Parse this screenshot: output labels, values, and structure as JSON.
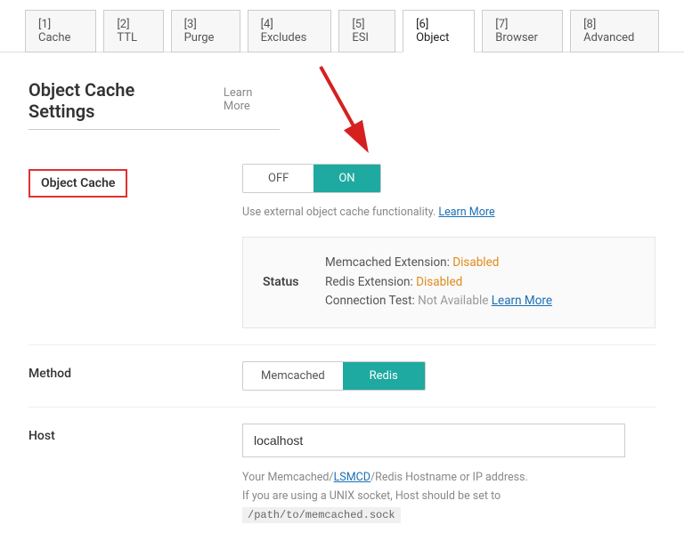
{
  "tabs": [
    {
      "label": "[1] Cache"
    },
    {
      "label": "[2] TTL"
    },
    {
      "label": "[3] Purge"
    },
    {
      "label": "[4] Excludes"
    },
    {
      "label": "[5] ESI"
    },
    {
      "label": "[6] Object"
    },
    {
      "label": "[7] Browser"
    },
    {
      "label": "[8] Advanced"
    }
  ],
  "active_tab_index": 5,
  "heading": "Object Cache Settings",
  "learn_more": "Learn More",
  "rows": {
    "object_cache": {
      "label": "Object Cache",
      "off": "OFF",
      "on": "ON",
      "desc_prefix": "Use external object cache functionality. ",
      "desc_link": "Learn More"
    },
    "status": {
      "label": "Status",
      "memcached_label": "Memcached Extension: ",
      "memcached_value": "Disabled",
      "redis_label": "Redis Extension: ",
      "redis_value": "Disabled",
      "conn_label": "Connection Test: ",
      "conn_value": "Not Available",
      "conn_link": "Learn More"
    },
    "method": {
      "label": "Method",
      "opt1": "Memcached",
      "opt2": "Redis"
    },
    "host": {
      "label": "Host",
      "value": "localhost",
      "hint1_pre": "Your Memcached/",
      "hint1_link": "LSMCD",
      "hint1_post": "/Redis Hostname or IP address.",
      "hint2_pre": "If you are using a UNIX socket, Host should be set to ",
      "hint2_code": "/path/to/memcached.sock"
    }
  }
}
